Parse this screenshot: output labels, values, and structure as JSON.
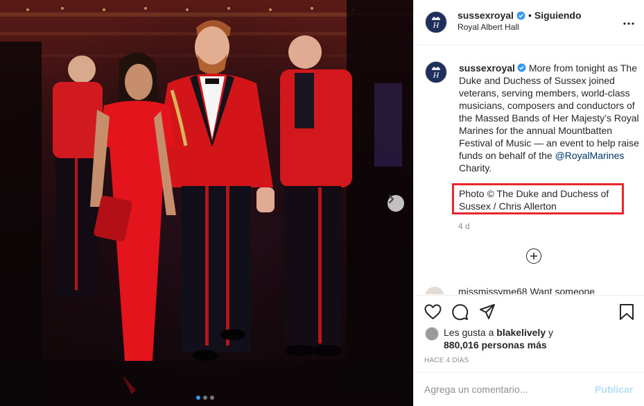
{
  "post": {
    "username": "sussexroyal",
    "separator": "•",
    "follow_status": "Siguiendo",
    "location": "Royal Albert Hall",
    "more_icon": "more-horizontal-icon",
    "photo_indicator": {
      "count": 3,
      "active_index": 0
    }
  },
  "caption": {
    "username": "sussexroyal",
    "text_before": " More from tonight as The Duke and Duchess of Sussex joined veterans, serving members, world-class musicians, composers and conductors of the Massed Bands of Her Majesty’s Royal Marines for the annual Mountbatten Festival of Music — an event to help raise funds on behalf of the ",
    "mention": "@RoyalMarines",
    "text_after": " Charity.",
    "credit": "Photo © The Duke and Duchess of Sussex / Chris Allerton",
    "credit_highlight_color": "#e8262b",
    "time_ago": "4 d"
  },
  "comments": {
    "partial_comment": "missmissyme68 Want someone"
  },
  "likes": {
    "prefix": "Les gusta a ",
    "user": "blakelively",
    "connector": " y",
    "count_text": "880,016 personas más"
  },
  "posted_label": "HACE 4 DÍAS",
  "comment_box": {
    "placeholder": "Agrega un comentario...",
    "publish_label": "Publicar"
  },
  "colors": {
    "verified": "#3897f0",
    "link": "#003569",
    "muted": "#8e8e8e",
    "publish_disabled": "#b2dffc"
  }
}
